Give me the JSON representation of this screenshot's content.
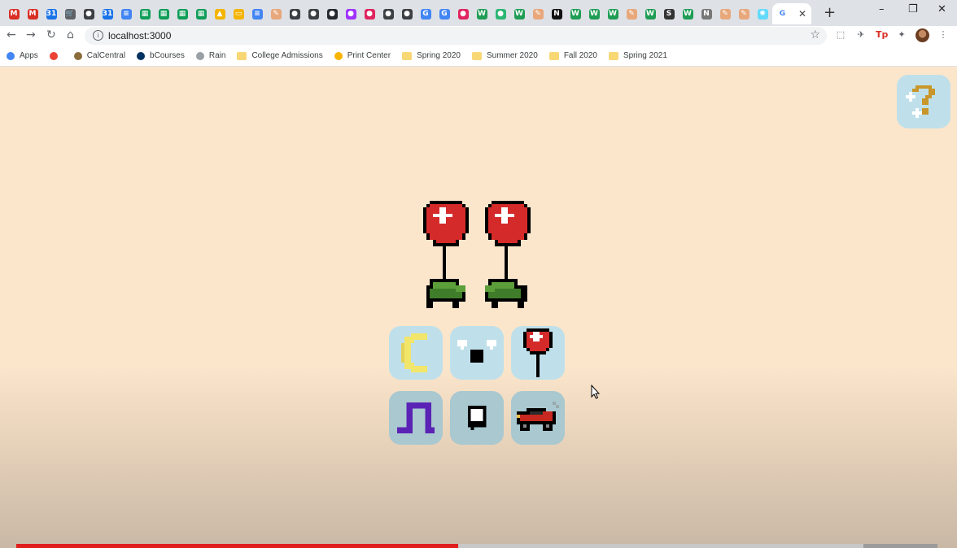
{
  "browser": {
    "tabs": [
      {
        "icon": "gmail-icon",
        "glyph": "M",
        "color": "#d93025"
      },
      {
        "icon": "gmail-icon",
        "glyph": "M",
        "color": "#d93025"
      },
      {
        "icon": "calendar-icon",
        "glyph": "31",
        "color": "#1a73e8"
      },
      {
        "icon": "cart-icon",
        "glyph": "🛒",
        "color": "#5f6368"
      },
      {
        "icon": "globe-icon",
        "glyph": "●",
        "color": "#3c4043"
      },
      {
        "icon": "calendar-icon",
        "glyph": "31",
        "color": "#1a73e8"
      },
      {
        "icon": "docs-icon",
        "glyph": "≡",
        "color": "#4285f4"
      },
      {
        "icon": "sheets-icon",
        "glyph": "▦",
        "color": "#0f9d58"
      },
      {
        "icon": "sheets-icon",
        "glyph": "▦",
        "color": "#0f9d58"
      },
      {
        "icon": "sheets-icon",
        "glyph": "▦",
        "color": "#0f9d58"
      },
      {
        "icon": "sheets-icon",
        "glyph": "▦",
        "color": "#0f9d58"
      },
      {
        "icon": "drive-icon",
        "glyph": "▲",
        "color": "#f4b400"
      },
      {
        "icon": "slides-icon",
        "glyph": "▭",
        "color": "#f4b400"
      },
      {
        "icon": "docs-icon",
        "glyph": "≡",
        "color": "#4285f4"
      },
      {
        "icon": "tutor-icon",
        "glyph": "✎",
        "color": "#e8a87c"
      },
      {
        "icon": "globe-icon",
        "glyph": "●",
        "color": "#3c4043"
      },
      {
        "icon": "globe-icon",
        "glyph": "●",
        "color": "#3c4043"
      },
      {
        "icon": "github-icon",
        "glyph": "●",
        "color": "#24292e"
      },
      {
        "icon": "messenger-icon",
        "glyph": "●",
        "color": "#a033ff"
      },
      {
        "icon": "record-icon",
        "glyph": "●",
        "color": "#e0245e"
      },
      {
        "icon": "globe-icon",
        "glyph": "●",
        "color": "#3c4043"
      },
      {
        "icon": "globe-icon",
        "glyph": "●",
        "color": "#3c4043"
      },
      {
        "icon": "google-icon",
        "glyph": "G",
        "color": "#4285f4"
      },
      {
        "icon": "google-icon",
        "glyph": "G",
        "color": "#4285f4"
      },
      {
        "icon": "record-icon",
        "glyph": "●",
        "color": "#e0245e"
      },
      {
        "icon": "w-icon",
        "glyph": "W",
        "color": "#1f9d55"
      },
      {
        "icon": "shield-icon",
        "glyph": "●",
        "color": "#2bb673"
      },
      {
        "icon": "w-icon",
        "glyph": "W",
        "color": "#1f9d55"
      },
      {
        "icon": "tutor-icon",
        "glyph": "✎",
        "color": "#e8a87c"
      },
      {
        "icon": "notion-icon",
        "glyph": "N",
        "color": "#111111"
      },
      {
        "icon": "w-icon",
        "glyph": "W",
        "color": "#1f9d55"
      },
      {
        "icon": "w-icon",
        "glyph": "W",
        "color": "#1f9d55"
      },
      {
        "icon": "w-icon",
        "glyph": "W",
        "color": "#1f9d55"
      },
      {
        "icon": "tutor-icon",
        "glyph": "✎",
        "color": "#e8a87c"
      },
      {
        "icon": "w-icon",
        "glyph": "W",
        "color": "#1f9d55"
      },
      {
        "icon": "s-icon",
        "glyph": "S",
        "color": "#333333"
      },
      {
        "icon": "w-icon",
        "glyph": "W",
        "color": "#1f9d55"
      },
      {
        "icon": "notion-icon",
        "glyph": "N",
        "color": "#777777"
      },
      {
        "icon": "tutor-icon",
        "glyph": "✎",
        "color": "#e8a87c"
      },
      {
        "icon": "tutor-icon",
        "glyph": "✎",
        "color": "#e8a87c"
      },
      {
        "icon": "react-icon",
        "glyph": "✺",
        "color": "#61dafb"
      }
    ],
    "active_tab": {
      "icon": "google-icon",
      "glyph": "G",
      "color": "#4285f4",
      "close": "✕"
    },
    "new_tab": "+",
    "window_controls": {
      "minimize": "–",
      "restore": "❐",
      "close": "✕"
    },
    "url": "localhost:3000",
    "extensions": [
      {
        "icon": "screenshot-icon",
        "glyph": "⬚",
        "color": "#5f6368"
      },
      {
        "icon": "bird-icon",
        "glyph": "✈",
        "color": "#5f6368"
      },
      {
        "icon": "tp-icon",
        "glyph": "Tp",
        "color": "#d93025"
      },
      {
        "icon": "puzzle-icon",
        "glyph": "✦",
        "color": "#5f6368"
      }
    ]
  },
  "bookmarks": [
    {
      "label": "Apps",
      "icon": "apps-icon",
      "color": "#4285f4"
    },
    {
      "label": "",
      "icon": "google-icon",
      "color": "#ea4335"
    },
    {
      "label": "CalCentral",
      "icon": "calcentral-icon",
      "color": "#8a6d3b"
    },
    {
      "label": "bCourses",
      "icon": "bcourses-icon",
      "color": "#003262"
    },
    {
      "label": "Rain",
      "icon": "rain-icon",
      "color": "#9aa0a6"
    },
    {
      "label": "College Admissions",
      "icon": "folder-icon",
      "color": "#f8d775"
    },
    {
      "label": "Print Center",
      "icon": "print-icon",
      "color": "#f8b500"
    },
    {
      "label": "Spring 2020",
      "icon": "folder-icon",
      "color": "#f8d775"
    },
    {
      "label": "Summer 2020",
      "icon": "folder-icon",
      "color": "#f8d775"
    },
    {
      "label": "Fall 2020",
      "icon": "folder-icon",
      "color": "#f8d775"
    },
    {
      "label": "Spring 2021",
      "icon": "folder-icon",
      "color": "#f8d775"
    }
  ],
  "app": {
    "background": "#fbe6cc",
    "tile_color": "#bfe0ea",
    "help_button": "help-question-icon",
    "hero": [
      "balloon-turtle-icon",
      "balloon-turtle-icon"
    ],
    "tiles": [
      {
        "name": "moon-tile",
        "icon": "moon-icon"
      },
      {
        "name": "eyes-tile",
        "icon": "face-icon"
      },
      {
        "name": "balloon-tile",
        "icon": "balloon-icon"
      },
      {
        "name": "wave-tile",
        "icon": "square-wave-icon"
      },
      {
        "name": "box-tile",
        "icon": "box-icon"
      },
      {
        "name": "car-tile",
        "icon": "car-icon"
      }
    ]
  },
  "video_progress": {
    "played": 0.48,
    "buffered": 0.92
  }
}
